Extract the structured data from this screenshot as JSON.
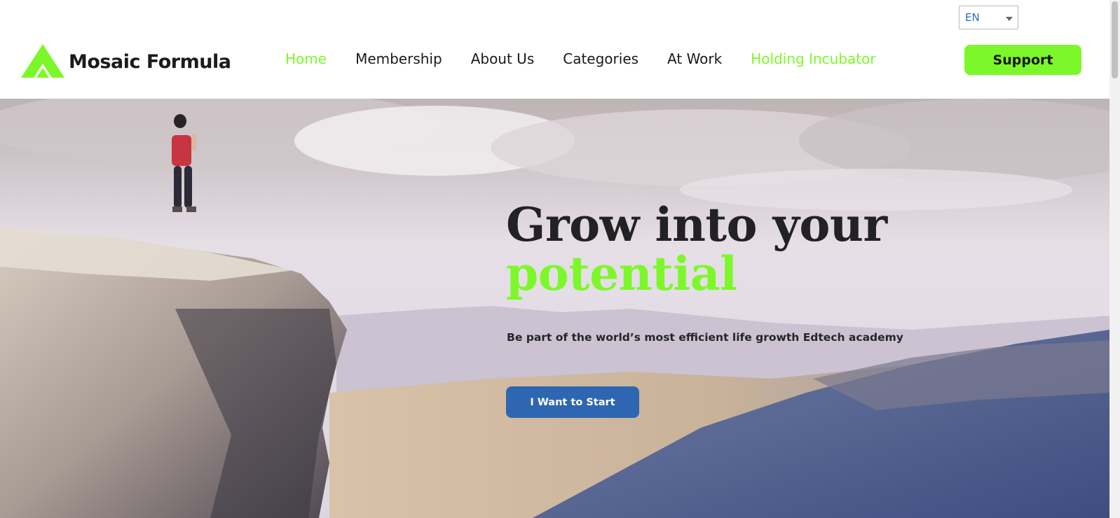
{
  "header": {
    "language": {
      "selected": "EN"
    },
    "logo": {
      "text": "Mosaic Formula",
      "icon": "mountain-a-logo-icon"
    },
    "nav": {
      "items": [
        {
          "label": "Home",
          "state": "active"
        },
        {
          "label": "Membership",
          "state": "normal"
        },
        {
          "label": "About Us",
          "state": "normal"
        },
        {
          "label": "Categories",
          "state": "normal"
        },
        {
          "label": "At Work",
          "state": "normal"
        },
        {
          "label": "Holding Incubator",
          "state": "highlight"
        }
      ]
    },
    "support_label": "Support"
  },
  "hero": {
    "title_line1": "Grow into your",
    "title_line2": "potential",
    "subtitle": "Be part of the world’s most efficient life growth Edtech academy",
    "cta_label": "I Want to Start",
    "background": "cliff-landscape-photo"
  },
  "colors": {
    "brand_green": "#7cf82a",
    "cta_blue": "#2f66b1",
    "text_dark": "#222222"
  }
}
